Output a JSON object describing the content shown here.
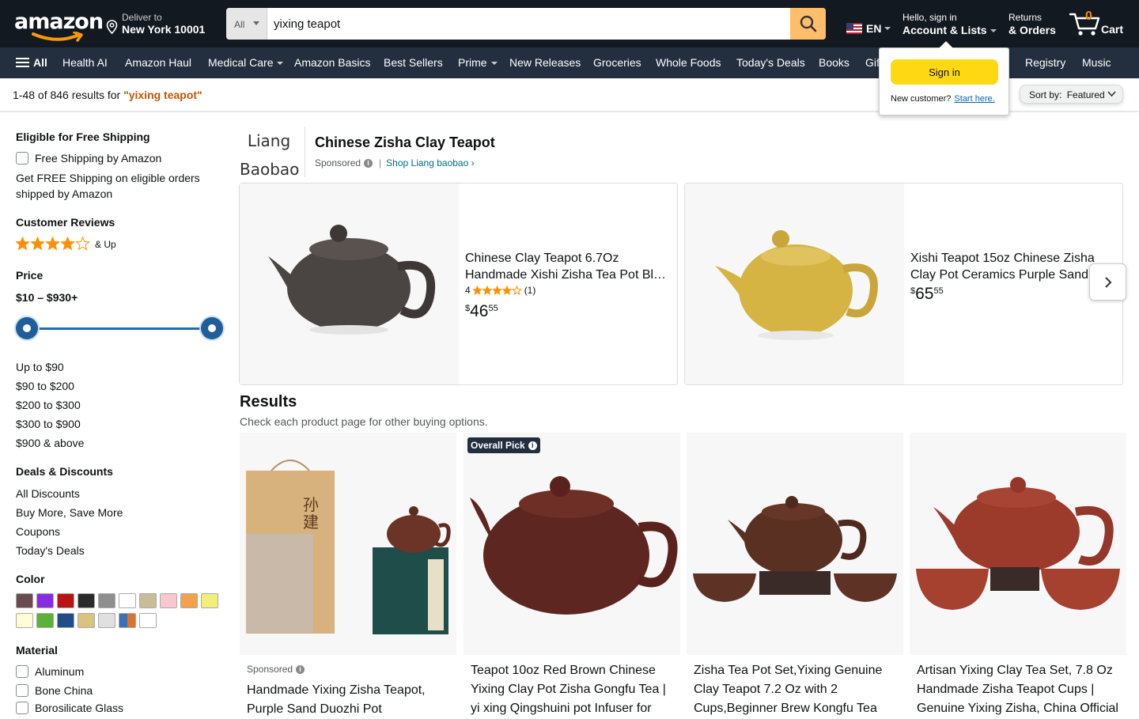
{
  "header": {
    "logo": "amazon",
    "deliver": {
      "line1": "Deliver to",
      "line2": "New York 10001"
    },
    "search": {
      "category": "All",
      "query": "yixing teapot"
    },
    "language": "EN",
    "account": {
      "line1": "Hello, sign in",
      "line2": "Account & Lists"
    },
    "returns": {
      "line1": "Returns",
      "line2": "& Orders"
    },
    "cart": {
      "count": "0",
      "label": "Cart"
    }
  },
  "nav": {
    "all": "All",
    "items": [
      "Health AI",
      "Amazon Haul",
      "Medical Care",
      "Amazon Basics",
      "Best Sellers",
      "Prime",
      "New Releases",
      "Groceries",
      "Whole Foods",
      "Today's Deals",
      "Books",
      "Gift",
      "Registry",
      "Music"
    ]
  },
  "signin_popover": {
    "button": "Sign in",
    "new_customer": "New customer?",
    "start_here": "Start here."
  },
  "results_bar": {
    "count_prefix": "1-48 of 846 results for ",
    "query": "\"yixing teapot\"",
    "sort_label": "Sort by:",
    "sort_value": "Featured"
  },
  "sidebar": {
    "shipping_heading": "Eligible for Free Shipping",
    "free_shipping": "Free Shipping by Amazon",
    "free_shipping_note_1": "Get FREE Shipping on eligible orders",
    "free_shipping_note_2": "shipped by Amazon",
    "reviews_heading": "Customer Reviews",
    "reviews_up": "& Up",
    "reviews_rating": 4,
    "price_heading": "Price",
    "price_range": "$10 – $930+",
    "price_links": [
      "Up to $90",
      "$90 to $200",
      "$200 to $300",
      "$300 to $900",
      "$900 & above"
    ],
    "deals_heading": "Deals & Discounts",
    "deals_links": [
      "All Discounts",
      "Buy More, Save More",
      "Coupons",
      "Today's Deals"
    ],
    "color_heading": "Color",
    "colors": [
      "#6b4b4f",
      "#8a2be2",
      "#b81414",
      "#2b2b2b",
      "#8f8f8f",
      "#ffffff",
      "#c9bd97",
      "#f9c7cf",
      "#f5a04a",
      "#f3ee7a",
      "#fffcd6",
      "#5bb234",
      "#234a89",
      "#d8c47f",
      "#e0e0e0",
      "multi",
      "#ffffff"
    ],
    "material_heading": "Material",
    "materials": [
      "Aluminum",
      "Bone China",
      "Borosilicate Glass"
    ]
  },
  "sponsored_brand": {
    "logo_line1": "Liang",
    "logo_line2": "Baobao",
    "title": "Chinese Zisha Clay Teapot",
    "sponsored": "Sponsored",
    "shop_link": "Shop Liang baobao ›",
    "products": [
      {
        "title": "Chinese Clay Teapot 6.7Oz Handmade Xishi Zisha Tea Pot Bl…",
        "rating_text": "4",
        "reviews": "(1)",
        "price_dollars": "46",
        "price_cents": "55",
        "color": "#4a4442"
      },
      {
        "title": "Xishi Teapot 15oz Chinese Zisha Clay Pot Ceramics Purple Sand …",
        "price_dollars": "65",
        "price_cents": "55",
        "color": "#d9b84a"
      }
    ]
  },
  "results": {
    "heading": "Results",
    "subheading": "Check each product page for other buying options.",
    "products": [
      {
        "sponsored": "Sponsored",
        "title": "Handmade Yixing Zisha Teapot, Purple Sand Duozhi Pot"
      },
      {
        "badge": "Overall Pick",
        "title": "Teapot 10oz Red Brown Chinese Yixing Clay Pot Zisha Gongfu Tea | yi xing Qingshuini pot Infuser for"
      },
      {
        "title": "Zisha Tea Pot Set,Yixing Genuine Clay Teapot 7.2 Oz with 2 Cups,Beginner Brew Kongfu Tea"
      },
      {
        "title": "Artisan Yixing Clay Tea Set, 7.8 Oz Handmade Zisha Teapot Cups | Genuine Yixing Zisha, China Official"
      }
    ]
  },
  "colors": {
    "header_bg": "#131921",
    "nav_bg": "#232f3e",
    "search_btn": "#febd69",
    "signin_btn": "#ffd814",
    "star": "#ff8f00",
    "link": "#007185",
    "query": "#c45500"
  }
}
